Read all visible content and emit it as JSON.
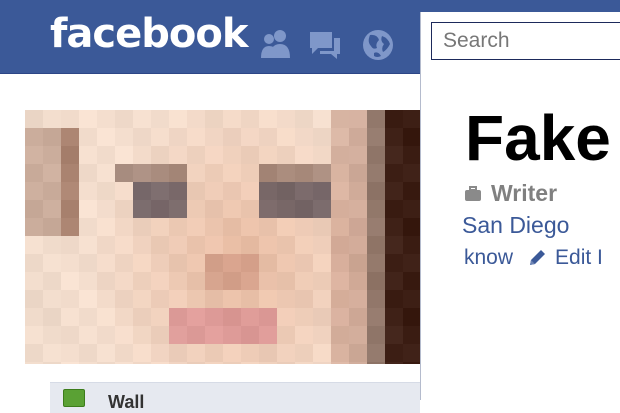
{
  "header": {
    "logo_text": "facebook",
    "brand_color": "#3b5998",
    "icons": [
      "friend-requests-icon",
      "messages-icon",
      "notifications-globe-icon"
    ]
  },
  "search": {
    "placeholder": "Search"
  },
  "profile": {
    "name": "Fake",
    "job_title": "Writer",
    "location": "San Diego",
    "know_link": "know",
    "edit_link": "Edit I"
  },
  "wall": {
    "label": "Wall"
  }
}
